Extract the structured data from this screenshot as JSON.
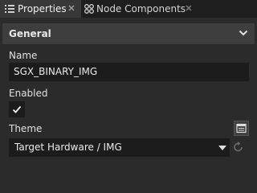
{
  "tabs": [
    {
      "label": "Properties",
      "icon": "list-icon",
      "active": true
    },
    {
      "label": "Node Components",
      "icon": "components-icon",
      "active": false
    }
  ],
  "section": {
    "title": "General",
    "icon": "chevron-down-icon"
  },
  "name": {
    "label": "Name",
    "value": "SGX_BINARY_IMG"
  },
  "enabled": {
    "label": "Enabled",
    "checked": true
  },
  "theme": {
    "label": "Theme",
    "value": "Target Hardware / IMG",
    "picker_icon": "theme-picker-icon",
    "reset_icon": "reset-icon"
  },
  "colors": {
    "accent": "#2b2b2b",
    "field": "#1c1c1c",
    "header": "#3e3e3e"
  }
}
